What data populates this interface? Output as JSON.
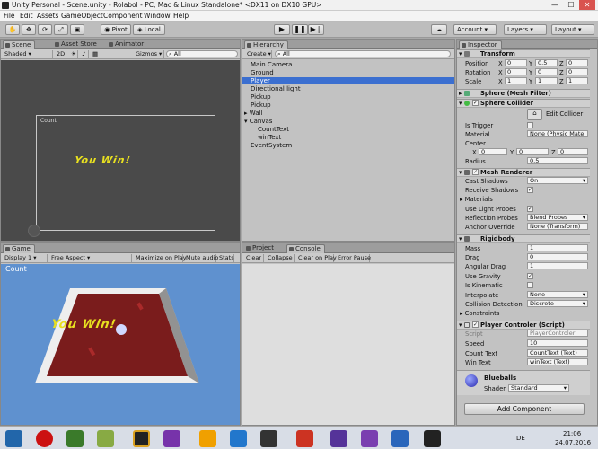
{
  "window": {
    "title": "Unity Personal - Scene.unity - Rolabol - PC, Mac & Linux Standalone* <DX11 on DX10 GPU>",
    "minimize": "—",
    "maximize": "☐",
    "close": "✕"
  },
  "menu": [
    "File",
    "Edit",
    "Assets",
    "GameObject",
    "Component",
    "Window",
    "Help"
  ],
  "toolbar": {
    "pivot": "Pivot",
    "local": "Local",
    "account": "Account",
    "layers": "Layers",
    "layout": "Layout"
  },
  "scene": {
    "tab_scene": "Scene",
    "tab_asset_store": "Asset Store",
    "tab_animator": "Animator",
    "shading": "Shaded",
    "mode2d": "2D",
    "gizmos": "Gizmos",
    "search": "All",
    "canvas_count": "Count",
    "canvas_win": "You Win!"
  },
  "game": {
    "tab": "Game",
    "display": "Display 1",
    "aspect": "Free Aspect",
    "maximize": "Maximize on Play",
    "mute": "Mute audio",
    "stats": "Stats",
    "count": "Count",
    "win": "You Win!"
  },
  "hierarchy": {
    "tab": "Hierarchy",
    "create": "Create",
    "search": "All",
    "items": [
      "Main Camera",
      "Ground",
      "Player",
      "Directional light",
      "Pickup",
      "Pickup",
      "Wall",
      "Canvas",
      "CountText",
      "winText",
      "EventSystem"
    ]
  },
  "console": {
    "tab_project": "Project",
    "tab_console": "Console",
    "clear": "Clear",
    "collapse": "Collapse",
    "clear_on_play": "Clear on Play",
    "error_pause": "Error Pause"
  },
  "inspector": {
    "tab": "Inspector",
    "transform": {
      "title": "Transform",
      "position": "Position",
      "rotation": "Rotation",
      "scale": "Scale",
      "x": "X",
      "y": "Y",
      "z": "Z",
      "pos": [
        "0",
        "0.5",
        "0"
      ],
      "rot": [
        "0",
        "0",
        "0"
      ],
      "scl": [
        "1",
        "1",
        "1"
      ]
    },
    "mesh_filter": {
      "title": "Sphere (Mesh Filter)"
    },
    "collider": {
      "title": "Sphere Collider",
      "edit": "Edit Collider",
      "is_trigger": "Is Trigger",
      "material": "Material",
      "material_val": "None (Physic Mate",
      "center": "Center",
      "cx": "0",
      "cy": "0",
      "cz": "0",
      "radius": "Radius",
      "radius_val": "0.5"
    },
    "renderer": {
      "title": "Mesh Renderer",
      "cast_shadows": "Cast Shadows",
      "cast_val": "On",
      "receive": "Receive Shadows",
      "materials": "Materials",
      "light_probes": "Use Light Probes",
      "reflection": "Reflection Probes",
      "reflection_val": "Blend Probes",
      "anchor": "Anchor Override",
      "anchor_val": "None (Transform)"
    },
    "rigidbody": {
      "title": "Rigidbody",
      "mass": "Mass",
      "mass_val": "1",
      "drag": "Drag",
      "drag_val": "0",
      "angular": "Angular Drag",
      "angular_val": "1",
      "gravity": "Use Gravity",
      "kinematic": "Is Kinematic",
      "interpolate": "Interpolate",
      "interp_val": "None",
      "collision": "Collision Detection",
      "collision_val": "Discrete",
      "constraints": "Constraints"
    },
    "script": {
      "title": "Player Controler (Script)",
      "script": "Script",
      "script_val": "PlayerControler",
      "speed": "Speed",
      "speed_val": "10",
      "count_text": "Count Text",
      "count_val": "CountText (Text)",
      "win_text": "Win Text",
      "win_val": "winText (Text)"
    },
    "material": {
      "name": "Blueballs",
      "shader": "Shader",
      "shader_val": "Standard"
    },
    "add_component": "Add Component"
  },
  "taskbar": {
    "time": "21:06",
    "date": "24.07.2016",
    "lang": "DE"
  },
  "colors": {
    "accent": "#3b6fd0",
    "win_text": "#e8e020",
    "game_bg": "#5f91cf",
    "board": "#7a1c1c"
  }
}
